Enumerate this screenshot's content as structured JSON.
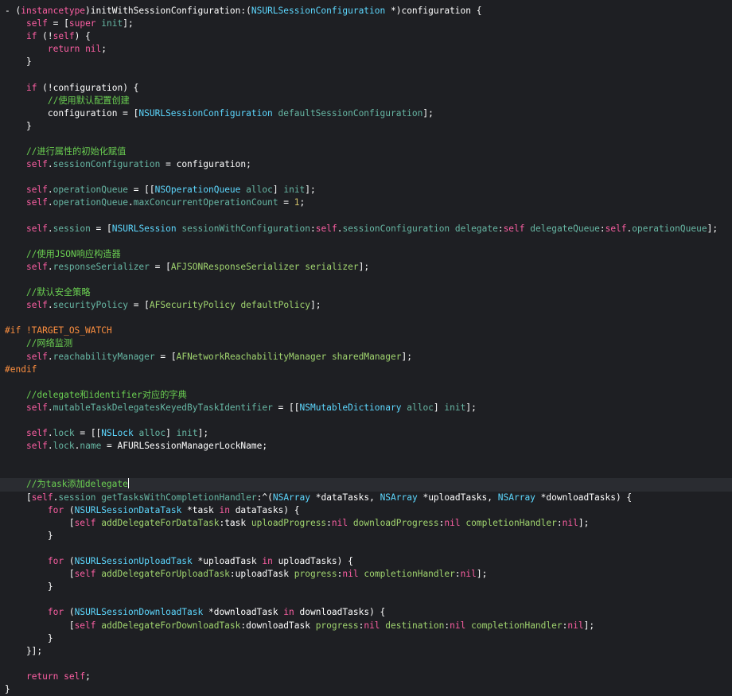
{
  "editor": {
    "colors": {
      "plain": "#ffffff",
      "keyword": "#fc5fa3",
      "class": "#5dd8ff",
      "method": "#67b7a4",
      "comment": "#6bd052",
      "number": "#d0bf69",
      "preprocessor": "#fd8f3f",
      "background": "#1e1f23",
      "current_line": "#2a2c31"
    },
    "current_line_index": 37,
    "lines": [
      [
        [
          "plain",
          "- ("
        ],
        [
          "keyword",
          "instancetype"
        ],
        [
          "plain",
          ")initWithSessionConfiguration:("
        ],
        [
          "class",
          "NSURLSessionConfiguration"
        ],
        [
          "plain",
          " *)configuration {"
        ]
      ],
      [
        [
          "plain",
          "    "
        ],
        [
          "keyword",
          "self"
        ],
        [
          "plain",
          " = ["
        ],
        [
          "keyword",
          "super"
        ],
        [
          "plain",
          " "
        ],
        [
          "method",
          "init"
        ],
        [
          "plain",
          "];"
        ]
      ],
      [
        [
          "plain",
          "    "
        ],
        [
          "keyword",
          "if"
        ],
        [
          "plain",
          " (!"
        ],
        [
          "keyword",
          "self"
        ],
        [
          "plain",
          ") {"
        ]
      ],
      [
        [
          "plain",
          "        "
        ],
        [
          "keyword",
          "return"
        ],
        [
          "plain",
          " "
        ],
        [
          "keyword",
          "nil"
        ],
        [
          "plain",
          ";"
        ]
      ],
      [
        [
          "plain",
          "    }"
        ]
      ],
      [],
      [
        [
          "plain",
          "    "
        ],
        [
          "keyword",
          "if"
        ],
        [
          "plain",
          " (!configuration) {"
        ]
      ],
      [
        [
          "comment",
          "        //使用默认配置创建"
        ]
      ],
      [
        [
          "plain",
          "        configuration = ["
        ],
        [
          "class",
          "NSURLSessionConfiguration"
        ],
        [
          "plain",
          " "
        ],
        [
          "method",
          "defaultSessionConfiguration"
        ],
        [
          "plain",
          "];"
        ]
      ],
      [
        [
          "plain",
          "    }"
        ]
      ],
      [],
      [
        [
          "comment",
          "    //进行属性的初始化赋值"
        ]
      ],
      [
        [
          "plain",
          "    "
        ],
        [
          "keyword",
          "self"
        ],
        [
          "plain",
          "."
        ],
        [
          "prop",
          "sessionConfiguration"
        ],
        [
          "plain",
          " = configuration;"
        ]
      ],
      [],
      [
        [
          "plain",
          "    "
        ],
        [
          "keyword",
          "self"
        ],
        [
          "plain",
          "."
        ],
        [
          "prop",
          "operationQueue"
        ],
        [
          "plain",
          " = [["
        ],
        [
          "class",
          "NSOperationQueue"
        ],
        [
          "plain",
          " "
        ],
        [
          "method",
          "alloc"
        ],
        [
          "plain",
          "] "
        ],
        [
          "method",
          "init"
        ],
        [
          "plain",
          "];"
        ]
      ],
      [
        [
          "plain",
          "    "
        ],
        [
          "keyword",
          "self"
        ],
        [
          "plain",
          "."
        ],
        [
          "prop",
          "operationQueue"
        ],
        [
          "plain",
          "."
        ],
        [
          "method",
          "maxConcurrentOperationCount"
        ],
        [
          "plain",
          " = "
        ],
        [
          "number",
          "1"
        ],
        [
          "plain",
          ";"
        ]
      ],
      [],
      [
        [
          "plain",
          "    "
        ],
        [
          "keyword",
          "self"
        ],
        [
          "plain",
          "."
        ],
        [
          "prop",
          "session"
        ],
        [
          "plain",
          " = ["
        ],
        [
          "class",
          "NSURLSession"
        ],
        [
          "plain",
          " "
        ],
        [
          "method",
          "sessionWithConfiguration"
        ],
        [
          "plain",
          ":"
        ],
        [
          "keyword",
          "self"
        ],
        [
          "plain",
          "."
        ],
        [
          "prop",
          "sessionConfiguration"
        ],
        [
          "plain",
          " "
        ],
        [
          "method",
          "delegate"
        ],
        [
          "plain",
          ":"
        ],
        [
          "keyword",
          "self"
        ],
        [
          "plain",
          " "
        ],
        [
          "method",
          "delegateQueue"
        ],
        [
          "plain",
          ":"
        ],
        [
          "keyword",
          "self"
        ],
        [
          "plain",
          "."
        ],
        [
          "prop",
          "operationQueue"
        ],
        [
          "plain",
          "];"
        ]
      ],
      [],
      [
        [
          "comment",
          "    //使用JSON响应构造器"
        ]
      ],
      [
        [
          "plain",
          "    "
        ],
        [
          "keyword",
          "self"
        ],
        [
          "plain",
          "."
        ],
        [
          "prop",
          "responseSerializer"
        ],
        [
          "plain",
          " = ["
        ],
        [
          "const",
          "AFJSONResponseSerializer"
        ],
        [
          "plain",
          " "
        ],
        [
          "const",
          "serializer"
        ],
        [
          "plain",
          "];"
        ]
      ],
      [],
      [
        [
          "comment",
          "    //默认安全策略"
        ]
      ],
      [
        [
          "plain",
          "    "
        ],
        [
          "keyword",
          "self"
        ],
        [
          "plain",
          "."
        ],
        [
          "prop",
          "securityPolicy"
        ],
        [
          "plain",
          " = ["
        ],
        [
          "const",
          "AFSecurityPolicy"
        ],
        [
          "plain",
          " "
        ],
        [
          "const",
          "defaultPolicy"
        ],
        [
          "plain",
          "];"
        ]
      ],
      [],
      [
        [
          "preproc",
          "#if !TARGET_OS_WATCH"
        ]
      ],
      [
        [
          "comment",
          "    //网络监测"
        ]
      ],
      [
        [
          "plain",
          "    "
        ],
        [
          "keyword",
          "self"
        ],
        [
          "plain",
          "."
        ],
        [
          "prop",
          "reachabilityManager"
        ],
        [
          "plain",
          " = ["
        ],
        [
          "const",
          "AFNetworkReachabilityManager"
        ],
        [
          "plain",
          " "
        ],
        [
          "const",
          "sharedManager"
        ],
        [
          "plain",
          "];"
        ]
      ],
      [
        [
          "preproc",
          "#endif"
        ]
      ],
      [],
      [
        [
          "comment",
          "    //delegate和identifier对应的字典"
        ]
      ],
      [
        [
          "plain",
          "    "
        ],
        [
          "keyword",
          "self"
        ],
        [
          "plain",
          "."
        ],
        [
          "prop",
          "mutableTaskDelegatesKeyedByTaskIdentifier"
        ],
        [
          "plain",
          " = [["
        ],
        [
          "class",
          "NSMutableDictionary"
        ],
        [
          "plain",
          " "
        ],
        [
          "method",
          "alloc"
        ],
        [
          "plain",
          "] "
        ],
        [
          "method",
          "init"
        ],
        [
          "plain",
          "];"
        ]
      ],
      [],
      [
        [
          "plain",
          "    "
        ],
        [
          "keyword",
          "self"
        ],
        [
          "plain",
          "."
        ],
        [
          "prop",
          "lock"
        ],
        [
          "plain",
          " = [["
        ],
        [
          "class",
          "NSLock"
        ],
        [
          "plain",
          " "
        ],
        [
          "method",
          "alloc"
        ],
        [
          "plain",
          "] "
        ],
        [
          "method",
          "init"
        ],
        [
          "plain",
          "];"
        ]
      ],
      [
        [
          "plain",
          "    "
        ],
        [
          "keyword",
          "self"
        ],
        [
          "plain",
          "."
        ],
        [
          "prop",
          "lock"
        ],
        [
          "plain",
          "."
        ],
        [
          "method",
          "name"
        ],
        [
          "plain",
          " = AFURLSessionManagerLockName;"
        ]
      ],
      [],
      [],
      [
        [
          "comment",
          "    //为task添加delegate"
        ]
      ],
      [
        [
          "plain",
          "    ["
        ],
        [
          "keyword",
          "self"
        ],
        [
          "plain",
          "."
        ],
        [
          "prop",
          "session"
        ],
        [
          "plain",
          " "
        ],
        [
          "method",
          "getTasksWithCompletionHandler"
        ],
        [
          "plain",
          ":^("
        ],
        [
          "class",
          "NSArray"
        ],
        [
          "plain",
          " *dataTasks, "
        ],
        [
          "class",
          "NSArray"
        ],
        [
          "plain",
          " *uploadTasks, "
        ],
        [
          "class",
          "NSArray"
        ],
        [
          "plain",
          " *downloadTasks) {"
        ]
      ],
      [
        [
          "plain",
          "        "
        ],
        [
          "keyword",
          "for"
        ],
        [
          "plain",
          " ("
        ],
        [
          "class",
          "NSURLSessionDataTask"
        ],
        [
          "plain",
          " *task "
        ],
        [
          "keyword",
          "in"
        ],
        [
          "plain",
          " dataTasks) {"
        ]
      ],
      [
        [
          "plain",
          "            ["
        ],
        [
          "keyword",
          "self"
        ],
        [
          "plain",
          " "
        ],
        [
          "const",
          "addDelegateForDataTask"
        ],
        [
          "plain",
          ":task "
        ],
        [
          "const",
          "uploadProgress"
        ],
        [
          "plain",
          ":"
        ],
        [
          "keyword",
          "nil"
        ],
        [
          "plain",
          " "
        ],
        [
          "const",
          "downloadProgress"
        ],
        [
          "plain",
          ":"
        ],
        [
          "keyword",
          "nil"
        ],
        [
          "plain",
          " "
        ],
        [
          "const",
          "completionHandler"
        ],
        [
          "plain",
          ":"
        ],
        [
          "keyword",
          "nil"
        ],
        [
          "plain",
          "];"
        ]
      ],
      [
        [
          "plain",
          "        }"
        ]
      ],
      [],
      [
        [
          "plain",
          "        "
        ],
        [
          "keyword",
          "for"
        ],
        [
          "plain",
          " ("
        ],
        [
          "class",
          "NSURLSessionUploadTask"
        ],
        [
          "plain",
          " *uploadTask "
        ],
        [
          "keyword",
          "in"
        ],
        [
          "plain",
          " uploadTasks) {"
        ]
      ],
      [
        [
          "plain",
          "            ["
        ],
        [
          "keyword",
          "self"
        ],
        [
          "plain",
          " "
        ],
        [
          "const",
          "addDelegateForUploadTask"
        ],
        [
          "plain",
          ":uploadTask "
        ],
        [
          "const",
          "progress"
        ],
        [
          "plain",
          ":"
        ],
        [
          "keyword",
          "nil"
        ],
        [
          "plain",
          " "
        ],
        [
          "const",
          "completionHandler"
        ],
        [
          "plain",
          ":"
        ],
        [
          "keyword",
          "nil"
        ],
        [
          "plain",
          "];"
        ]
      ],
      [
        [
          "plain",
          "        }"
        ]
      ],
      [],
      [
        [
          "plain",
          "        "
        ],
        [
          "keyword",
          "for"
        ],
        [
          "plain",
          " ("
        ],
        [
          "class",
          "NSURLSessionDownloadTask"
        ],
        [
          "plain",
          " *downloadTask "
        ],
        [
          "keyword",
          "in"
        ],
        [
          "plain",
          " downloadTasks) {"
        ]
      ],
      [
        [
          "plain",
          "            ["
        ],
        [
          "keyword",
          "self"
        ],
        [
          "plain",
          " "
        ],
        [
          "const",
          "addDelegateForDownloadTask"
        ],
        [
          "plain",
          ":downloadTask "
        ],
        [
          "const",
          "progress"
        ],
        [
          "plain",
          ":"
        ],
        [
          "keyword",
          "nil"
        ],
        [
          "plain",
          " "
        ],
        [
          "const",
          "destination"
        ],
        [
          "plain",
          ":"
        ],
        [
          "keyword",
          "nil"
        ],
        [
          "plain",
          " "
        ],
        [
          "const",
          "completionHandler"
        ],
        [
          "plain",
          ":"
        ],
        [
          "keyword",
          "nil"
        ],
        [
          "plain",
          "];"
        ]
      ],
      [
        [
          "plain",
          "        }"
        ]
      ],
      [
        [
          "plain",
          "    }];"
        ]
      ],
      [],
      [
        [
          "plain",
          "    "
        ],
        [
          "keyword",
          "return"
        ],
        [
          "plain",
          " "
        ],
        [
          "keyword",
          "self"
        ],
        [
          "plain",
          ";"
        ]
      ],
      [
        [
          "plain",
          "}"
        ]
      ]
    ]
  }
}
